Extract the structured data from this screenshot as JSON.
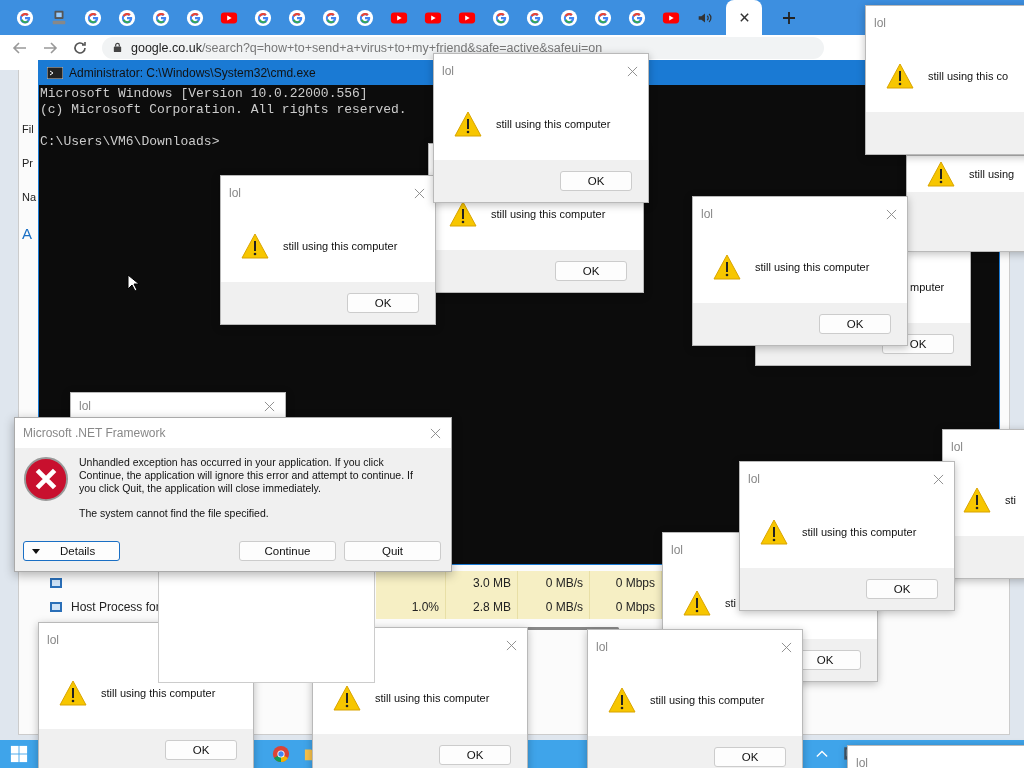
{
  "browser": {
    "tabs": [
      {
        "kind": "google",
        "selected": false
      },
      {
        "kind": "computer",
        "selected": false
      },
      {
        "kind": "google",
        "selected": false
      },
      {
        "kind": "google",
        "selected": false
      },
      {
        "kind": "google",
        "selected": false
      },
      {
        "kind": "google",
        "selected": false
      },
      {
        "kind": "youtube",
        "selected": false
      },
      {
        "kind": "google",
        "selected": false
      },
      {
        "kind": "google",
        "selected": false
      },
      {
        "kind": "google",
        "selected": false
      },
      {
        "kind": "google",
        "selected": false
      },
      {
        "kind": "youtube",
        "selected": false
      },
      {
        "kind": "youtube",
        "selected": false
      },
      {
        "kind": "youtube",
        "selected": false
      },
      {
        "kind": "google",
        "selected": false
      },
      {
        "kind": "google",
        "selected": false
      },
      {
        "kind": "google",
        "selected": false
      },
      {
        "kind": "google",
        "selected": false
      },
      {
        "kind": "google",
        "selected": false
      },
      {
        "kind": "youtube",
        "selected": false
      },
      {
        "kind": "audio",
        "selected": false
      },
      {
        "kind": "blank",
        "selected": true
      }
    ],
    "address_host": "google.co.uk",
    "address_path": "/search?q=how+to+send+a+virus+to+my+friend&safe=active&safeui=on"
  },
  "task_manager": {
    "side_labels": [
      "Fil",
      "Pr",
      "Na",
      "A"
    ],
    "rows": [
      {
        "memory": "3.0 MB",
        "disk": "0 MB/s",
        "network": "0 Mbps"
      },
      {
        "name": "Host Process for",
        "cpu": "1.0%",
        "memory": "2.8 MB",
        "disk": "0 MB/s",
        "network": "0 Mbps"
      }
    ]
  },
  "cmd": {
    "title": "Administrator: C:\\Windows\\System32\\cmd.exe",
    "lines": [
      "Microsoft Windows [Version 10.0.22000.556]",
      "(c) Microsoft Corporation. All rights reserved."
    ],
    "prompt": "C:\\Users\\VM6\\Downloads>"
  },
  "message_boxes": [
    {
      "message": "still using this computer",
      "button": "OK"
    },
    {
      "message": "mputer",
      "button": "OK"
    },
    {
      "title": "lol"
    },
    {
      "title": "lol",
      "message": "sti"
    },
    {
      "title": "lol",
      "message": "still using this computer",
      "button": "OK"
    },
    {
      "title": "lol",
      "message": "sti",
      "button": "OK"
    },
    {
      "title": "lol",
      "message": "still using this computer",
      "button": "OK"
    },
    {
      "message": "still using this computer",
      "button": "OK"
    },
    {
      "title": "lol",
      "message": "still using this computer",
      "button": "OK"
    },
    {
      "title": "lol",
      "message": "still using this computer",
      "button": "OK"
    },
    {
      "title": "lol",
      "message": "still using this co"
    },
    {
      "title": "lol",
      "message": "still using this computer",
      "button": "OK"
    },
    {
      "message": "still using"
    },
    {
      "title": "lol",
      "message": "still using this computer",
      "button": "OK"
    },
    {
      "title": "lol"
    }
  ],
  "net_dialog": {
    "title": "Microsoft .NET Framework",
    "message": [
      "Unhandled exception has occurred in your application. If you click Continue, the application will ignore this error and attempt to continue. If you click Quit, the application will close immediately.",
      "The system cannot find the file specified."
    ],
    "buttons": [
      {
        "kind": "details",
        "label": "Details"
      },
      {
        "kind": "plain",
        "label": "Continue"
      },
      {
        "kind": "plain",
        "label": "Quit"
      }
    ]
  }
}
